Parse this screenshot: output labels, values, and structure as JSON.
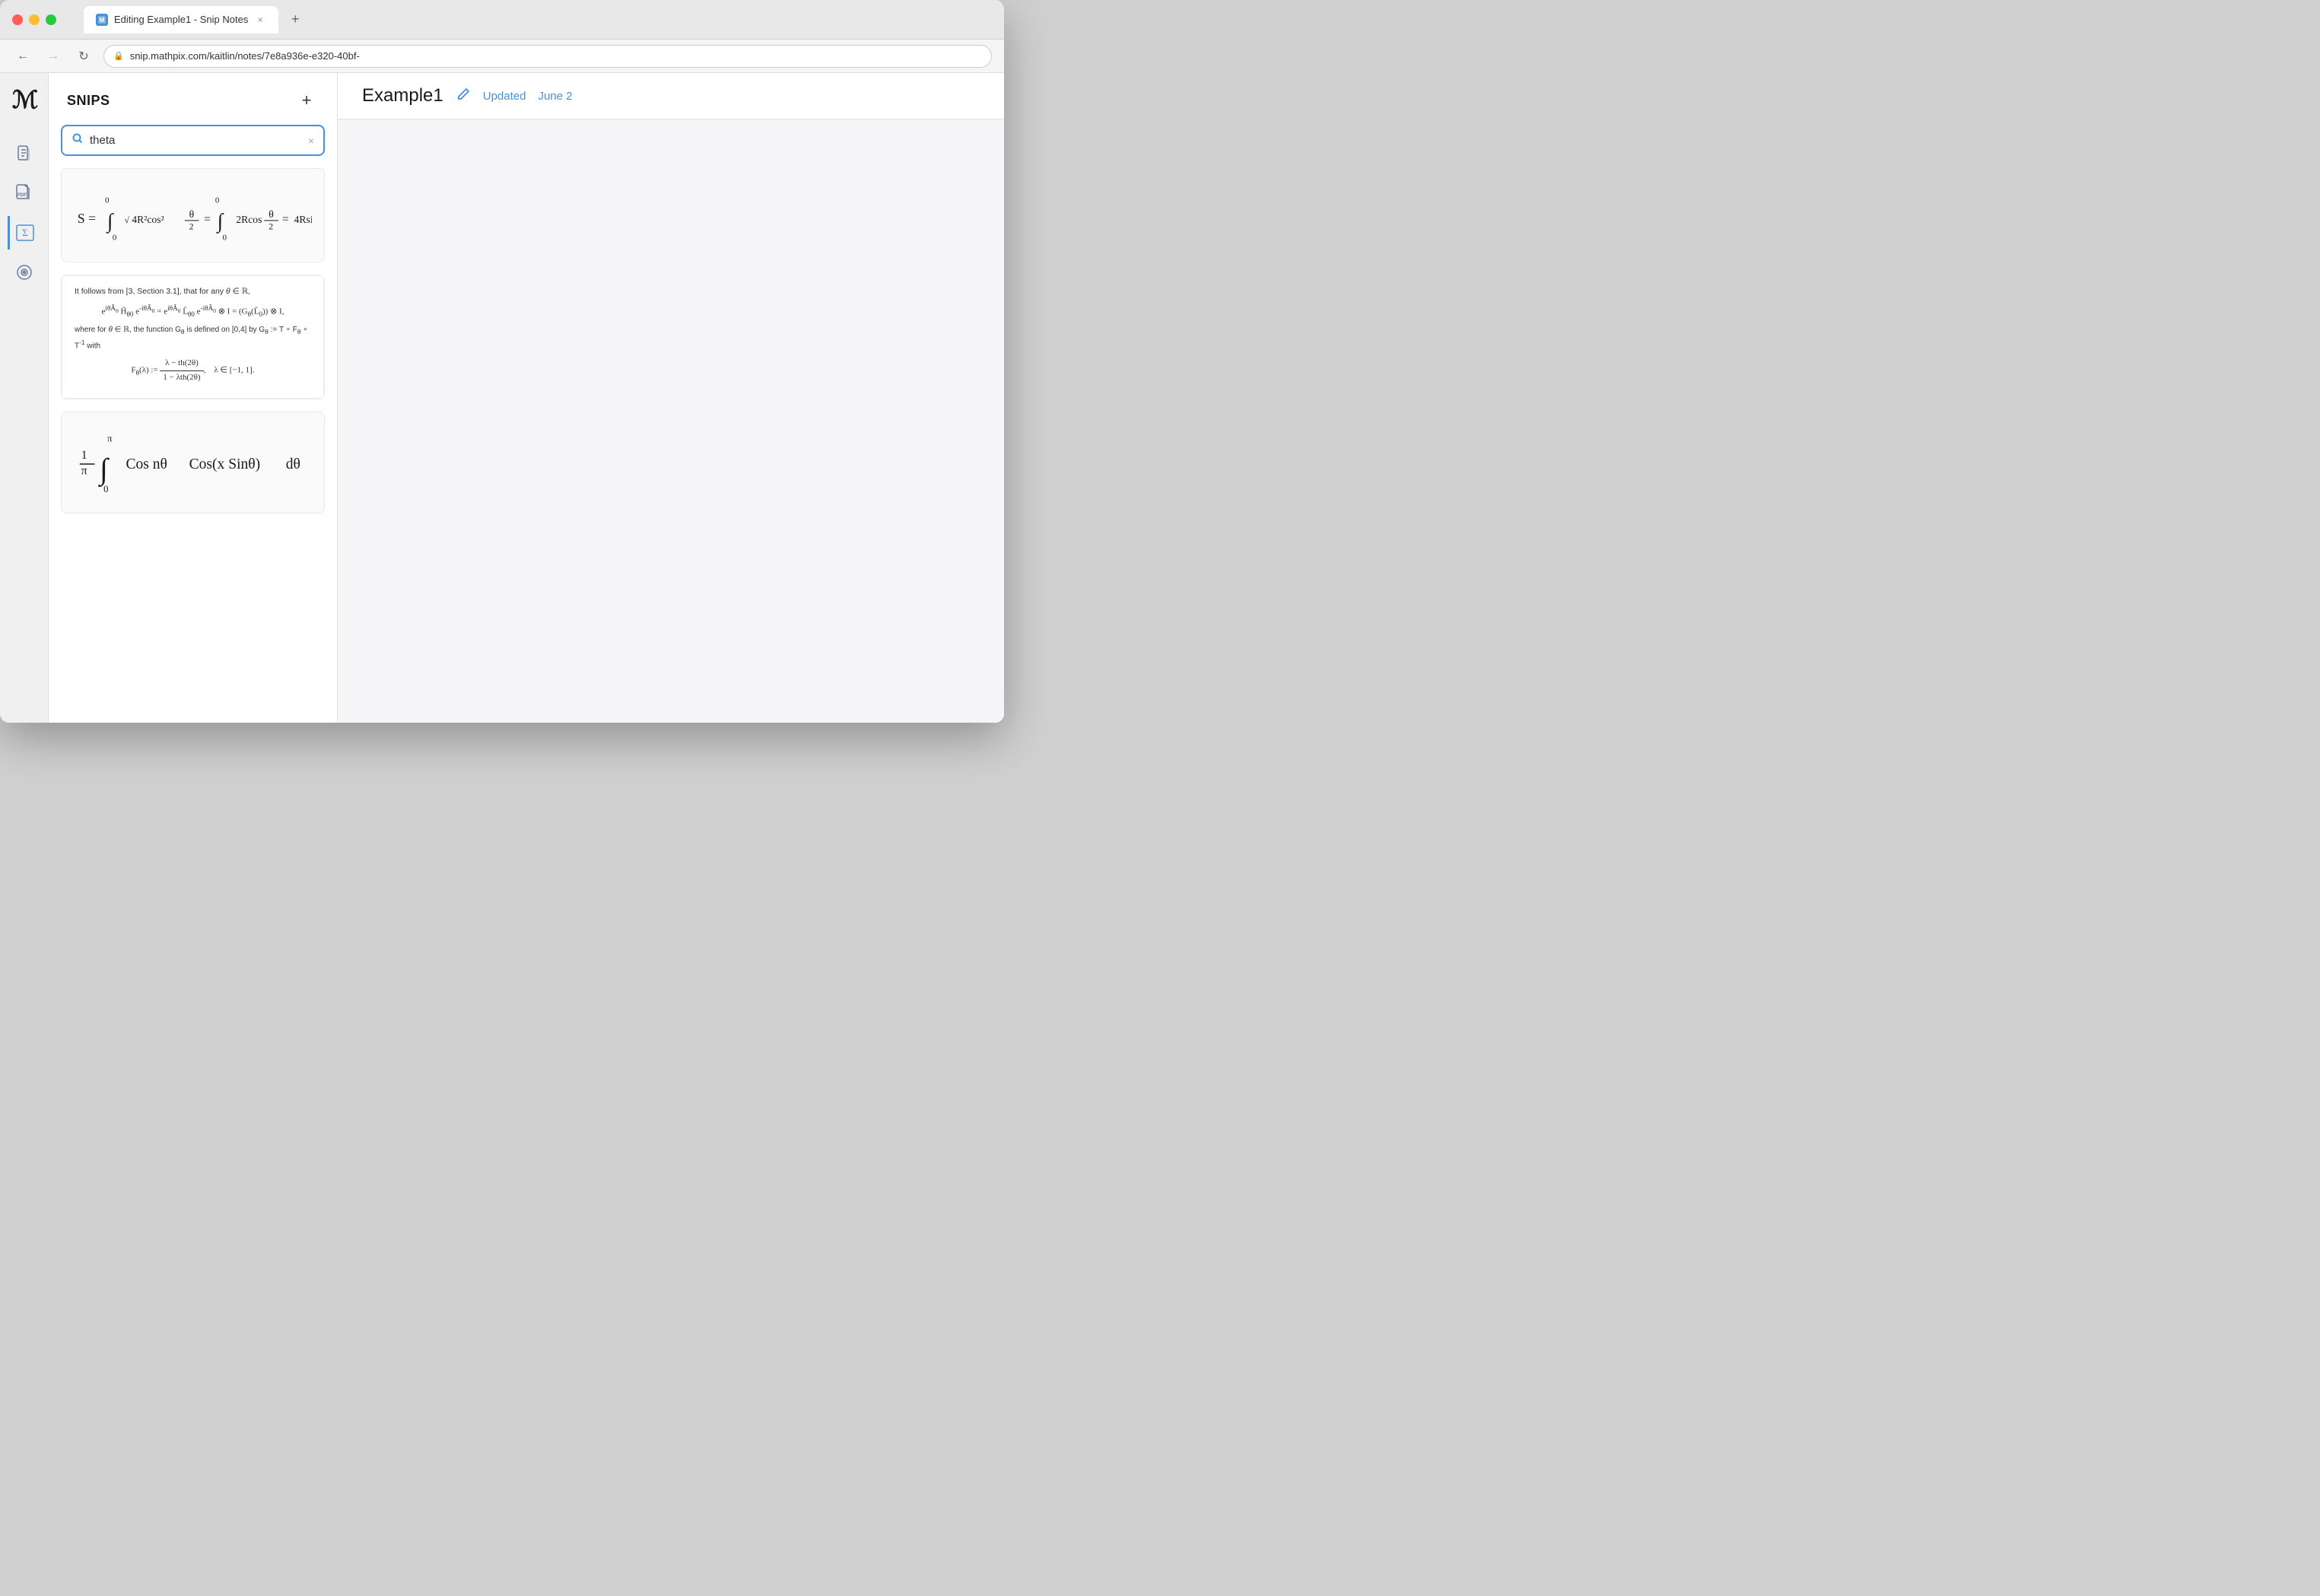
{
  "browser": {
    "tab_title": "Editing Example1 - Snip Notes",
    "tab_close": "×",
    "new_tab": "+",
    "nav_back": "←",
    "nav_forward": "→",
    "nav_refresh": "↻",
    "address": "snip.mathpix.com/kaitlin/notes/7e8a936e-e320-40bf-",
    "lock_icon": "🔒"
  },
  "sidebar": {
    "logo": "M",
    "icons": [
      {
        "name": "document-icon",
        "symbol": "📄"
      },
      {
        "name": "pdf-icon",
        "symbol": "PDF"
      },
      {
        "name": "formula-icon",
        "symbol": "Σ"
      },
      {
        "name": "camera-icon",
        "symbol": "⊙"
      }
    ]
  },
  "snips_panel": {
    "title": "SNIPS",
    "add_button": "+",
    "search": {
      "placeholder": "theta",
      "value": "theta",
      "clear": "×"
    },
    "items": [
      {
        "id": "snip-1",
        "type": "handwritten-math",
        "description": "Integral equation with R and theta"
      },
      {
        "id": "snip-2",
        "type": "typeset-math",
        "description": "It follows from theorem about theta in R"
      },
      {
        "id": "snip-3",
        "type": "handwritten-math",
        "description": "Integral cos n theta cos x sin theta"
      }
    ]
  },
  "right_panel": {
    "note_title": "Example1",
    "updated_label": "Updated",
    "date_label": "June 2"
  }
}
